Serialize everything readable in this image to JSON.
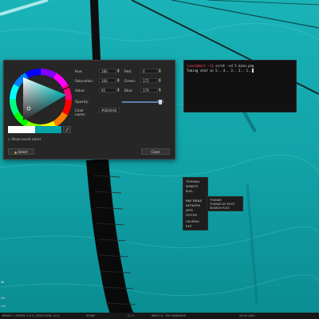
{
  "colors": {
    "dialog_bg": "#262626",
    "accent_swatch": "#00a4a8",
    "prompt_red": "#ff4d4d",
    "terminal_bg": "#111111",
    "statusbar_bg": "#171717"
  },
  "color_dialog": {
    "fields": {
      "hue": {
        "label": "Hue:",
        "value": "180"
      },
      "saturation": {
        "label": "Saturation:",
        "value": "100"
      },
      "value": {
        "label": "Value:",
        "value": "65"
      },
      "red": {
        "label": "Red:",
        "value": "0"
      },
      "green": {
        "label": "Green:",
        "value": "172"
      },
      "blue": {
        "label": "Blue:",
        "value": "179"
      }
    },
    "opacity": {
      "label": "Opacity:",
      "value": "255",
      "fraction": 1.0
    },
    "color_name": {
      "label": "Color name:",
      "value": "#00A4A8"
    },
    "show_saved_colors": "Show saved colors",
    "select_button": "Select",
    "close_button": "Close",
    "eyedropper_icon": "eyedropper-icon"
  },
  "terminal": {
    "prompt_user": "[user@host ~]$",
    "command": "scrot -cd 5 mine.png",
    "output": "Taking shot in 5.. 4.. 3.. 2.. 1.."
  },
  "context_menu": {
    "items": [
      "TERMINAL",
      "WEBSITE",
      "RUN...",
      "FILE TOOLS",
      "NETWORK",
      "APPS",
      "SYSTEM",
      "OB MENU",
      "EXIT"
    ],
    "submenu": [
      "THUNAR",
      "THUNAR AS ROOT",
      "SEARCH FILES"
    ]
  },
  "statusbar": {
    "left": "BRUSH: 1 PRESS: 0.0 0 | SELECTION: (0,0)",
    "mid1": "SCRAP",
    "mid2": "0 / 0",
    "mid3": "WEB 2.0 : FILE MANAGER",
    "right": "00:00 1000"
  },
  "left_edge_text": [
    "Wi",
    "0%",
    "1.8"
  ]
}
